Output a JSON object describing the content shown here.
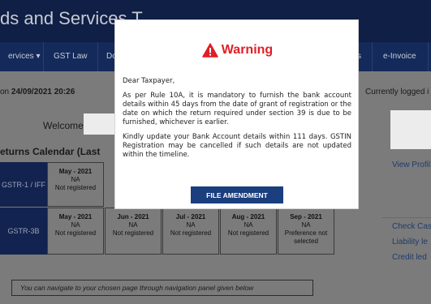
{
  "header": {
    "title": "ds and Services T"
  },
  "nav": {
    "items": [
      {
        "label": "ervices ▾"
      },
      {
        "label": "GST Law"
      },
      {
        "label": "Do"
      },
      {
        "label": "s"
      },
      {
        "label": "e-Invoice"
      }
    ]
  },
  "page": {
    "login_prefix": "on ",
    "login_date": "24/09/2021 20:26",
    "logged_in": "Currently logged i",
    "welcome": "Welcome",
    "calendar_title": "eturns Calendar (Last",
    "view_profile": "View Profil",
    "links": [
      "Check Cas",
      "Liability le",
      "Credit led"
    ],
    "nav_hint": "You can navigate to your chosen page through navigation panel given below"
  },
  "calendar": {
    "rows": [
      {
        "label": "GSTR-1 / IFF",
        "cells": [
          {
            "month": "May - 2021",
            "status1": "NA",
            "status2": "Not registered"
          },
          {
            "month": "",
            "status1": "",
            "status2": ""
          },
          {
            "month": "",
            "status1": "",
            "status2": ""
          },
          {
            "month": "",
            "status1": "",
            "status2": ""
          },
          {
            "month": "",
            "status1": "",
            "status2": ""
          }
        ]
      },
      {
        "label": "GSTR-3B",
        "cells": [
          {
            "month": "May - 2021",
            "status1": "NA",
            "status2": "Not registered"
          },
          {
            "month": "Jun - 2021",
            "status1": "NA",
            "status2": "Not registered"
          },
          {
            "month": "Jul - 2021",
            "status1": "NA",
            "status2": "Not registered"
          },
          {
            "month": "Aug - 2021",
            "status1": "NA",
            "status2": "Not registered"
          },
          {
            "month": "Sep - 2021",
            "status1": "NA",
            "status2": "Preference not selected"
          }
        ]
      }
    ]
  },
  "modal": {
    "icon": "warning-triangle-icon",
    "title": "Warning",
    "greeting": "Dear Taxpayer,",
    "para1": "As per Rule 10A, it is mandatory to furnish the bank account details within 45 days from the date of grant of registration or the date on which the return required under section 39 is due to be furnished, whichever is earlier.",
    "para2": "Kindly update your Bank Account details within 111 days. GSTIN Registration may be cancelled if such details are not updated within the timeline.",
    "button": "FILE AMENDMENT"
  },
  "colors": {
    "warning_red": "#e11f26",
    "button_blue": "#1a3e7e",
    "header_navy": "#0f1f45"
  }
}
